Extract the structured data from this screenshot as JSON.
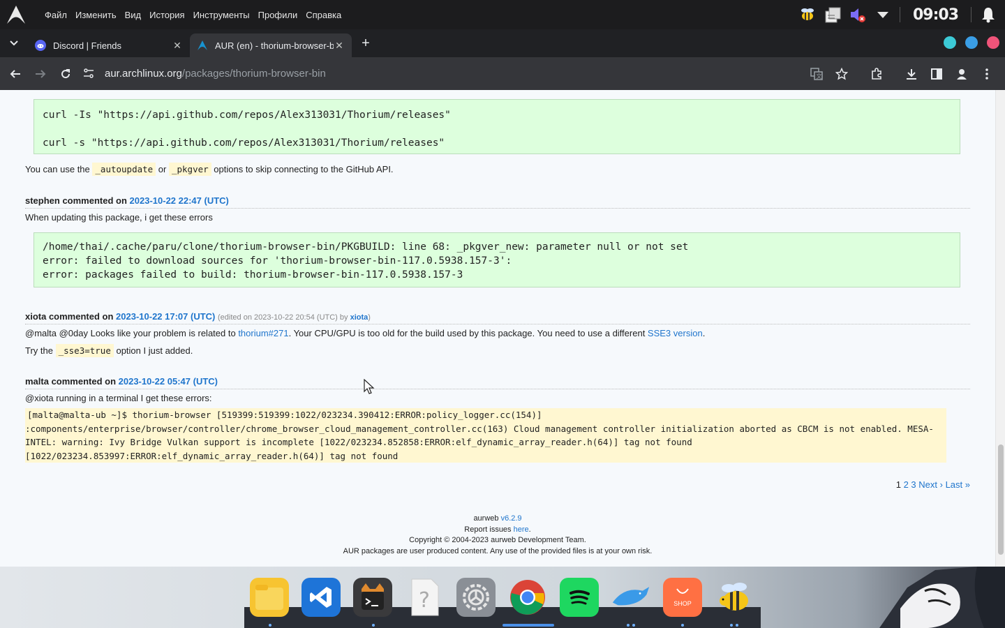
{
  "system_bar": {
    "menu": [
      "Файл",
      "Изменить",
      "Вид",
      "История",
      "Инструменты",
      "Профили",
      "Справка"
    ],
    "clock": "09:03"
  },
  "tabs": [
    {
      "title": "Discord | Friends",
      "close": "✕"
    },
    {
      "title": "AUR (en) - thorium-browser-bin",
      "close": "✕"
    }
  ],
  "new_tab": "+",
  "address": {
    "host": "aur.archlinux.org",
    "path": "/packages/thorium-browser-bin"
  },
  "page": {
    "block1_lines": [
      "curl -Is \"https://api.github.com/repos/Alex313031/Thorium/releases\"",
      "",
      "curl -s \"https://api.github.com/repos/Alex313031/Thorium/releases\""
    ],
    "block1_after": {
      "prefix": "You can use the ",
      "code1": "_autoupdate",
      "mid": " or ",
      "code2": "_pkgver",
      "suffix": " options to skip connecting to the GitHub API."
    },
    "comments": [
      {
        "author": "stephen commented on ",
        "date": "2023-10-22 22:47 (UTC)",
        "text": "When updating this package, i get these errors",
        "code": [
          "/home/thai/.cache/paru/clone/thorium-browser-bin/PKGBUILD: line 68: _pkgver_new: parameter null or not set",
          "error: failed to download sources for 'thorium-browser-bin-117.0.5938.157-3':",
          "error: packages failed to build: thorium-browser-bin-117.0.5938.157-3"
        ]
      },
      {
        "author": "xiota commented on ",
        "date": "2023-10-22 17:07 (UTC)",
        "edited_prefix": "(edited on 2023-10-22 20:54 (UTC) by ",
        "edited_by": "xiota",
        "edited_suffix": ")",
        "text_a": "@malta @0day Looks like your problem is related to ",
        "link_a": "thorium#271",
        "text_b": ". Your CPU/GPU is too old for the build used by this package. You need to use a different ",
        "link_b": "SSE3 version",
        "text_c": ".",
        "try_prefix": "Try the ",
        "try_code": "_sse3=true",
        "try_suffix": " option I just added."
      },
      {
        "author": "malta commented on ",
        "date": "2023-10-22 05:47 (UTC)",
        "text": "@xiota running in a terminal I get these errors:",
        "code": [
          "[malta@malta-ub ~]$ thorium-browser [519399:519399:1022/023234.390412:ERROR:policy_logger.cc(154)]",
          ":components/enterprise/browser/controller/chrome_browser_cloud_management_controller.cc(163) Cloud management controller initialization aborted as CBCM is not enabled. MESA-",
          "INTEL: warning: Ivy Bridge Vulkan support is incomplete [1022/023234.852858:ERROR:elf_dynamic_array_reader.h(64)] tag not found",
          "[1022/023234.853997:ERROR:elf_dynamic_array_reader.h(64)] tag not found"
        ]
      }
    ],
    "pager": {
      "current": "1",
      "p2": "2",
      "p3": "3",
      "next": "Next ›",
      "last": "Last »"
    },
    "footer": {
      "aurweb": "aurweb ",
      "version": "v6.2.9",
      "report_prefix": "Report issues ",
      "report_link": "here",
      "report_suffix": ".",
      "copyright": "Copyright © 2004-2023 aurweb Development Team.",
      "disclaimer": "AUR packages are user produced content. Any use of the provided files is at your own risk."
    }
  },
  "dock": {
    "shop_label": "SHOP"
  },
  "colors": {
    "link": "#1f75cc",
    "code_green_bg": "#ddffdd",
    "code_yellow_bg": "#fff7d1",
    "page_bg": "#f6f9fc"
  }
}
